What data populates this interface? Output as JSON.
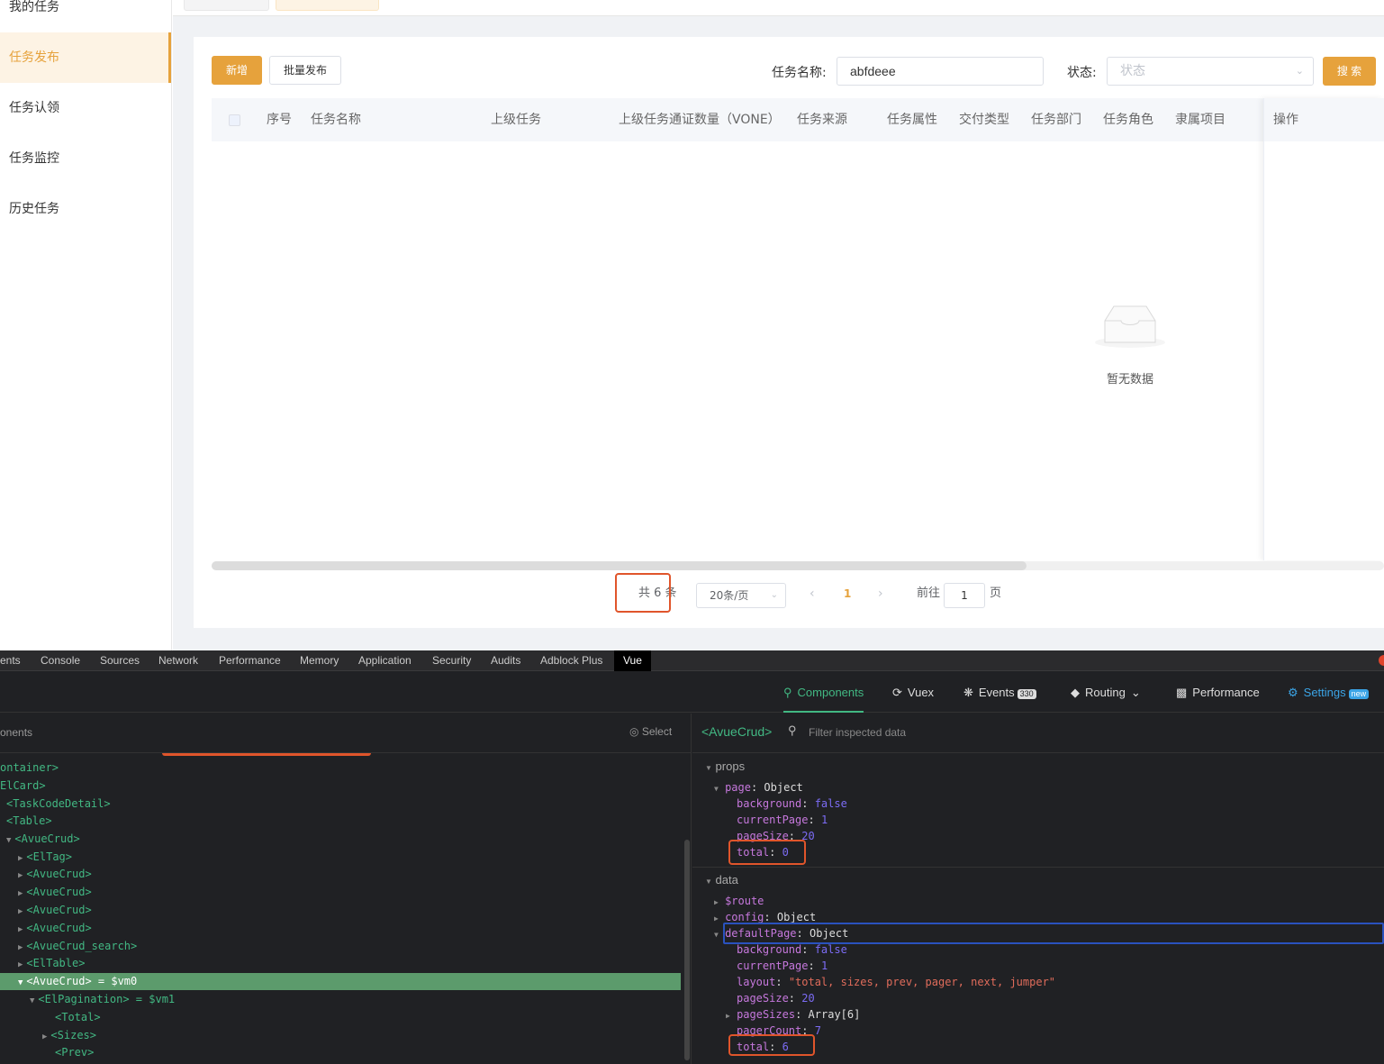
{
  "sidebar": {
    "items": [
      {
        "label": "我的任务",
        "active": false
      },
      {
        "label": "任务发布",
        "active": true
      },
      {
        "label": "任务认领",
        "active": false
      },
      {
        "label": "任务监控",
        "active": false
      },
      {
        "label": "历史任务",
        "active": false
      }
    ]
  },
  "toolbar": {
    "add_label": "新增",
    "batch_label": "批量发布",
    "task_name_label": "任务名称:",
    "task_name_value": "abfdeee",
    "status_label": "状态:",
    "status_placeholder": "状态",
    "search_label": "搜 索"
  },
  "table": {
    "columns": [
      "序号",
      "任务名称",
      "上级任务",
      "上级任务通证数量（VONE）",
      "任务来源",
      "任务属性",
      "交付类型",
      "任务部门",
      "任务角色",
      "隶属项目"
    ],
    "action_column": "操作",
    "empty_text": "暂无数据"
  },
  "pagination": {
    "total_text": "共 6 条",
    "page_size_text": "20条/页",
    "current_page": "1",
    "goto_label": "前往",
    "goto_value": "1",
    "page_suffix": "页"
  },
  "devtools": {
    "tabs": [
      "ents",
      "Console",
      "Sources",
      "Network",
      "Performance",
      "Memory",
      "Application",
      "Security",
      "Audits",
      "Adblock Plus",
      "Vue"
    ],
    "vue_nav": {
      "components": "Components",
      "vuex": "Vuex",
      "events": "Events",
      "events_count": "330",
      "routing": "Routing",
      "performance": "Performance",
      "settings": "Settings",
      "settings_badge": "new"
    },
    "left_title": "onents",
    "select_label": "Select",
    "tree": [
      "ontainer>",
      "ElCard>",
      "<TaskCodeDetail>",
      "<Table>",
      "<AvueCrud>",
      "<ElTag>",
      "<AvueCrud>",
      "<AvueCrud>",
      "<AvueCrud>",
      "<AvueCrud>",
      "<AvueCrud_search>",
      "<ElTable>",
      "<AvueCrud> = $vm0",
      "<ElPagination> = $vm1",
      "<Total>",
      "<Sizes>",
      "<Prev>"
    ],
    "inspected": "<AvueCrud>",
    "filter_placeholder": "Filter inspected data",
    "props_label": "props",
    "data_label": "data",
    "props": {
      "page": "Object",
      "background": "false",
      "currentPage": "1",
      "pageSize": "20",
      "total": "0"
    },
    "data": {
      "route": "$route",
      "config": "Object",
      "defaultPage": "Object",
      "background": "false",
      "currentPage": "1",
      "layout": "\"total, sizes, prev, pager, next, jumper\"",
      "pageSize": "20",
      "pageSizes": "Array[6]",
      "pagerCount": "7",
      "total": "6"
    }
  }
}
